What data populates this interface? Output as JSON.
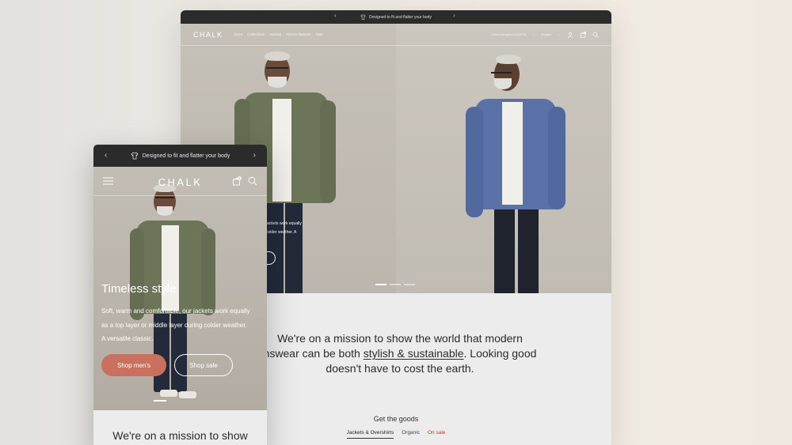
{
  "desktop": {
    "announcement": "Designed to fit and flatter your body",
    "logo": "CHALK",
    "menu": [
      "Store",
      "Collections",
      "Journal",
      "Theme features",
      "Sale"
    ],
    "country": "United Kingdom (GBP £)",
    "language": "English",
    "cart_count": "0",
    "hero_partial_text": [
      "jackets work equally",
      "colder weather. A"
    ],
    "mission": {
      "before": "We're on a mission to show the world that modern",
      "line2_start": "nswear can be both ",
      "link": "stylish & sustainable",
      "after": ". Looking good",
      "line3": "doesn't have to cost the earth."
    },
    "goods_title": "Get the goods",
    "tabs": [
      "Jackets & Overshirts",
      "Organic",
      "On sale"
    ]
  },
  "mobile": {
    "announcement": "Designed to fit and flatter your body",
    "logo": "CHALK",
    "cart_count": "0",
    "hero_title": "Timeless style",
    "hero_text": "Soft, warm and comfortable, our jackets work equally as a top layer or middle layer during colder weather. A versatile classic.",
    "primary_button": "Shop men's",
    "secondary_button": "Shop sale",
    "mission": "We're on a mission to show"
  },
  "colors": {
    "accent_button": "#c9705f",
    "sale_tab": "#c0392b",
    "announcement_bar": "#2b2b2b"
  },
  "icons": {
    "tshirt": "tshirt-icon",
    "account": "user-icon",
    "cart": "bag-icon",
    "search": "search-icon",
    "menu": "hamburger-icon",
    "prev": "chevron-left-icon",
    "next": "chevron-right-icon"
  }
}
